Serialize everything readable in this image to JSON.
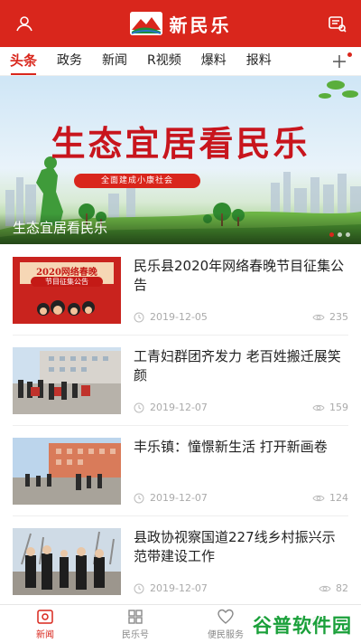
{
  "header": {
    "brand": "新民乐",
    "user_icon": "user-icon",
    "message_icon": "message-icon",
    "colors": {
      "brand_red": "#d9261c"
    }
  },
  "tabs": [
    {
      "label": "头条",
      "active": true
    },
    {
      "label": "政务"
    },
    {
      "label": "新闻"
    },
    {
      "label": "R视频"
    },
    {
      "label": "爆料"
    },
    {
      "label": "报料"
    }
  ],
  "banner": {
    "title": "生态宜居看民乐",
    "subtitle": "全面建成小康社会",
    "caption": "生态宜居看民乐"
  },
  "news": [
    {
      "title": "民乐县2020年网络春晚节目征集公告",
      "date": "2019-12-05",
      "views": "235",
      "thumb_text_1": "2020网络春晚",
      "thumb_text_2": "节目征集公告"
    },
    {
      "title": "工青妇群团齐发力 老百姓搬迁展笑颜",
      "date": "2019-12-07",
      "views": "159"
    },
    {
      "title": "丰乐镇：憧憬新生活 打开新画卷",
      "date": "2019-12-07",
      "views": "124"
    },
    {
      "title": "县政协视察国道227线乡村振兴示范带建设工作",
      "date": "2019-12-07",
      "views": "82"
    }
  ],
  "bottom_nav": [
    {
      "label": "新闻",
      "icon": "news-icon",
      "active": true
    },
    {
      "label": "民乐号",
      "icon": "grid-icon"
    },
    {
      "label": "便民服务",
      "icon": "heart-icon"
    },
    {
      "label": "",
      "icon": "profile-icon"
    }
  ],
  "watermark": "谷普软件园"
}
